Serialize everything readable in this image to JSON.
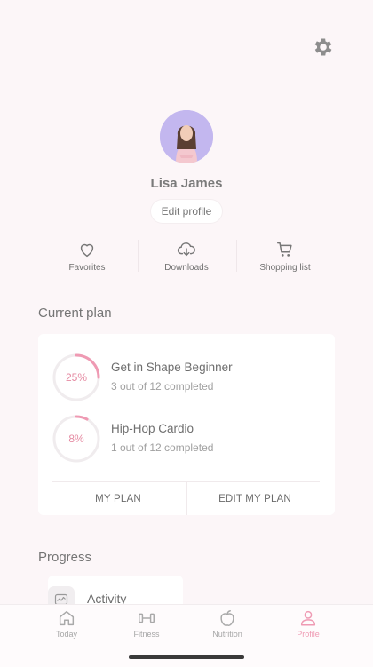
{
  "profile": {
    "name": "Lisa James",
    "edit_label": "Edit profile"
  },
  "quick_actions": [
    {
      "label": "Favorites",
      "icon": "heart-icon"
    },
    {
      "label": "Downloads",
      "icon": "cloud-download-icon"
    },
    {
      "label": "Shopping list",
      "icon": "cart-icon"
    }
  ],
  "current_plan": {
    "title": "Current plan",
    "plans": [
      {
        "progress_label": "25%",
        "progress": 0.25,
        "name": "Get in Shape Beginner",
        "status": "3 out of 12 completed"
      },
      {
        "progress_label": "8%",
        "progress": 0.08,
        "name": "Hip-Hop Cardio",
        "status": "1 out of 12 completed"
      }
    ],
    "my_plan_label": "MY PLAN",
    "edit_plan_label": "EDIT MY PLAN"
  },
  "progress": {
    "title": "Progress",
    "activity_label": "Activity"
  },
  "tabs": [
    {
      "label": "Today",
      "icon": "home-icon",
      "active": false
    },
    {
      "label": "Fitness",
      "icon": "dumbbell-icon",
      "active": false
    },
    {
      "label": "Nutrition",
      "icon": "apple-icon",
      "active": false
    },
    {
      "label": "Profile",
      "icon": "person-icon",
      "active": true
    }
  ],
  "colors": {
    "background": "#fcf6f8",
    "accent": "#ef9ab3",
    "ring_track": "#f0ecee",
    "avatar_bg": "#c3b7ef"
  }
}
